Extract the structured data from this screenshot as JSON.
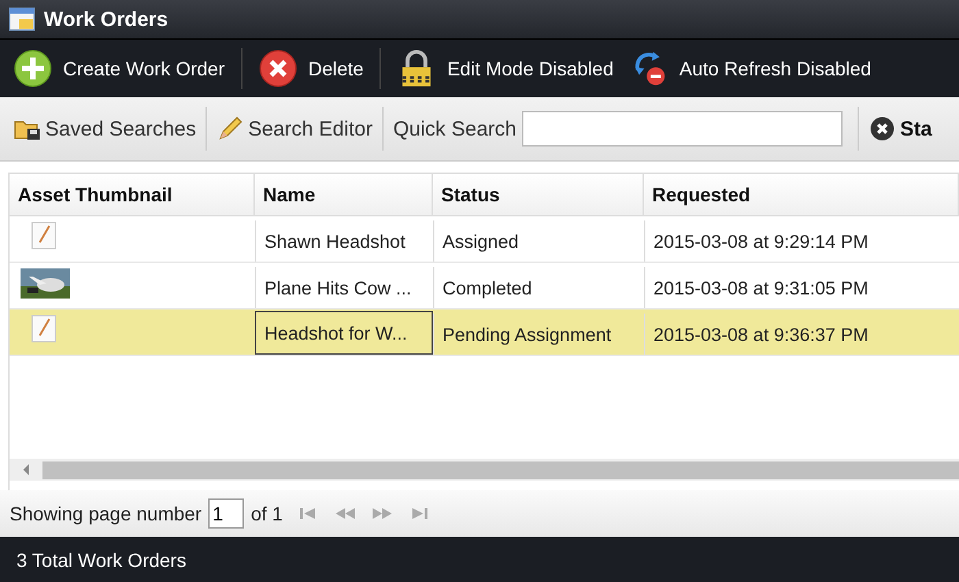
{
  "window": {
    "title": "Work Orders"
  },
  "toolbar": [
    {
      "kind": "create",
      "label": "Create Work Order"
    },
    {
      "kind": "delete",
      "label": "Delete"
    },
    {
      "kind": "lock",
      "label": "Edit Mode Disabled"
    },
    {
      "kind": "refresh",
      "label": "Auto Refresh Disabled"
    }
  ],
  "search_bar": {
    "saved_searches": "Saved Searches",
    "search_editor": "Search Editor",
    "quick_search_label": "Quick Search",
    "clear_label": "Sta"
  },
  "table": {
    "columns": [
      "Asset Thumbnail",
      "Name",
      "Status",
      "Requested"
    ],
    "rows": [
      {
        "kind": "document",
        "name": "Shawn Headshot",
        "status": "Assigned",
        "requested": "2015-03-08 at 9:29:14 PM",
        "selected": false
      },
      {
        "kind": "picture",
        "name": "Plane Hits Cow ...",
        "status": "Completed",
        "requested": "2015-03-08 at 9:31:05 PM",
        "selected": false
      },
      {
        "kind": "document",
        "name": "Headshot for W...",
        "status": "Pending Assignment",
        "requested": "2015-03-08 at 9:36:37 PM",
        "selected": true
      }
    ]
  },
  "pager": {
    "label": "Showing page number",
    "page": "1",
    "of": "of 1"
  },
  "status_bar": "3 Total Work Orders"
}
